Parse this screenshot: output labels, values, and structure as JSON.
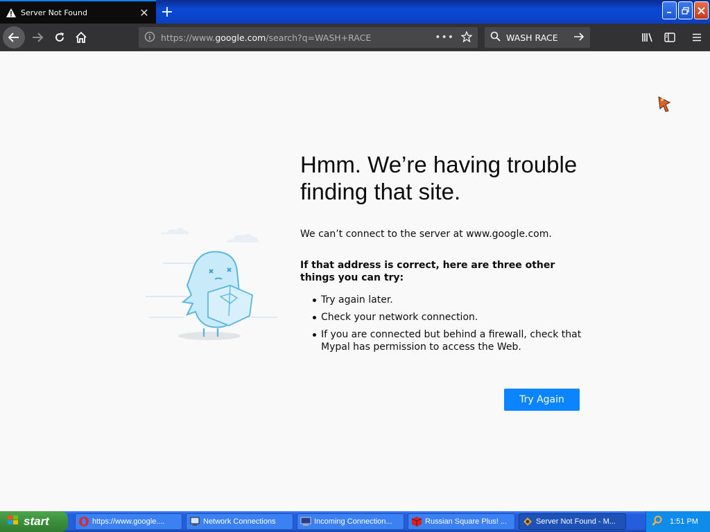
{
  "browser": {
    "tab_title": "Server Not Found",
    "url_prefix": "https://www.",
    "url_host": "google.com",
    "url_suffix": "/search?q=WASH+RACE",
    "page_actions": "•••",
    "search_value": "WASH RACE"
  },
  "error": {
    "title": "Hmm. We’re having trouble finding that site.",
    "description": "We can’t connect to the server at www.google.com.",
    "suggestions_heading": "If that address is correct, here are three other things you can try:",
    "suggestions": [
      "Try again later.",
      "Check your network connection.",
      "If you are connected but behind a firewall, check that Mypal has permission to access the Web."
    ],
    "button_label": "Try Again"
  },
  "taskbar": {
    "start_label": "start",
    "tasks": [
      {
        "label": "https://www.google...."
      },
      {
        "label": "Network Connections"
      },
      {
        "label": "Incoming Connection..."
      },
      {
        "label": "Russian Square Plus! ..."
      },
      {
        "label": "Server Not Found - M..."
      }
    ],
    "clock": "1:51 PM"
  },
  "colors": {
    "accent": "#0a84ff",
    "toolbar": "#323234",
    "page_bg": "#f9f9fa"
  }
}
